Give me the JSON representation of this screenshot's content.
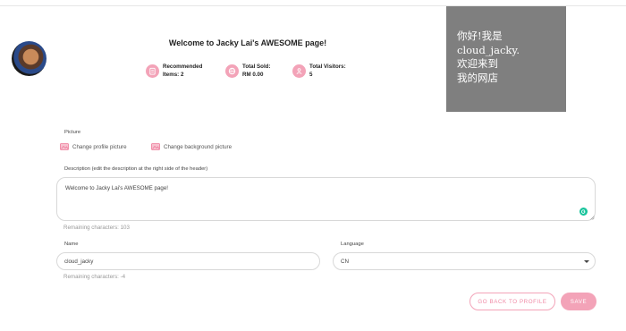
{
  "header": {
    "welcome": "Welcome to Jacky Lai's AWESOME page!",
    "stats": [
      {
        "label": "Recommended",
        "value": "Items: 2",
        "icon": "clipboard-icon"
      },
      {
        "label": "Total Sold:",
        "value": "RM 0.00",
        "icon": "globe-icon"
      },
      {
        "label": "Total Visitors:",
        "value": "5",
        "icon": "people-icon"
      }
    ],
    "banner_text": "你好!我是\ncloud_jacky.\n欢迎来到\n我的网店",
    "accent_color": "#f3a3b8",
    "banner_bg": "#7f7f7f"
  },
  "form": {
    "picture_label": "Picture",
    "change_profile": "Change profile picture",
    "change_background": "Change background picture",
    "description_label": "Description (edit the description at the right side of the header)",
    "description_value": "Welcome to Jacky Lai's AWESOME page!",
    "description_remaining": "Remaining characters: 103",
    "name_label": "Name",
    "name_value": "cloud_jacky",
    "name_remaining": "Remaining characters: -4",
    "language_label": "Language",
    "language_value": "CN",
    "back_button": "GO BACK TO PROFILE",
    "save_button": "SAVE"
  }
}
